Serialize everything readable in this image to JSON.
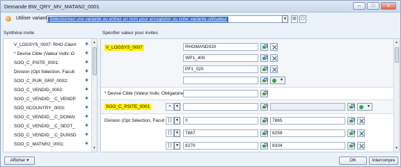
{
  "window": {
    "title": "Demande BW_QRY_MV_MATAN2_0001",
    "controls": [
      "–",
      "□",
      "x"
    ]
  },
  "variant": {
    "label": "Utiliser variante",
    "placeholder_text": "Sélectionnez une variante ou entrez un nom pour enregistrer ou créer variante utilisateur"
  },
  "left": {
    "header": "Synthèse invite",
    "items": [
      {
        "label": "V_LOGSYS_0007: RHO Client",
        "marker": "✱"
      },
      {
        "label": "* Devise Cible (Valeur Indiv. O",
        "marker": "✱"
      },
      {
        "label": "SOO_C_PSITE_0001:",
        "marker": "✱"
      },
      {
        "label": "Division (Opt Sélection, Facult",
        "marker": "✱"
      },
      {
        "label": "SOO_C_PUR_GRP_0002:",
        "marker": "✱"
      },
      {
        "label": "SOO_C_VENDID_0002:",
        "marker": "✱"
      },
      {
        "label": "SOO_C_VENDID__C_VENDP",
        "marker": "✱"
      },
      {
        "label": "SOO_0COUNTRY_0003:",
        "marker": "✱"
      },
      {
        "label": "SOO_C_VENDID__C_DOMAI",
        "marker": "✱"
      },
      {
        "label": "SOO_C_VENDID__C_SEGT_",
        "marker": "✱"
      },
      {
        "label": "SOO_C_VENDID__C_DUNSD",
        "marker": "✱"
      },
      {
        "label": "SOO_C_MATNR2_0001:",
        "marker": "✱"
      }
    ]
  },
  "right": {
    "header": "Spécifier valeur pour invites",
    "logsys": {
      "label": "V_LOGSYS_0007",
      "values": [
        "RHOMAND020",
        "WP1_400",
        "PF1_020",
        ""
      ]
    },
    "devise": {
      "label": "* Devise Cible (Valeur Indiv. Obligatoire"
    },
    "psite": {
      "label": "SOO_C_PSITE_0001",
      "operator": "="
    },
    "division": {
      "label": "Division (Opt Sélection, Facult",
      "rows": [
        {
          "op": "[ ]",
          "from": "0",
          "to": "7865"
        },
        {
          "op": "[ ]",
          "from": "7867",
          "to": "8259"
        },
        {
          "op": "[ ]",
          "from": "8270",
          "to": "8334"
        }
      ]
    }
  },
  "footer": {
    "afficher": "Afficher",
    "ok": "OK",
    "interrompre": "Interrompre"
  }
}
